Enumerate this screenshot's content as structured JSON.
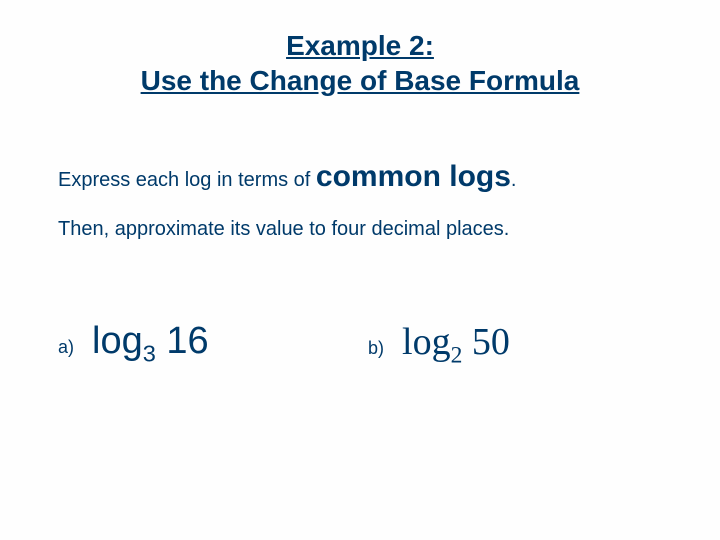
{
  "title": {
    "line1": "Example 2:",
    "line2": "Use the Change of Base Formula"
  },
  "instructions": {
    "lead": "Express each log in terms of ",
    "emphasis": "common logs",
    "tail": ".",
    "line2": "Then, approximate its value to four decimal places."
  },
  "problems": {
    "a": {
      "label": "a)",
      "log_word": "log",
      "base": "3",
      "arg": " 16"
    },
    "b": {
      "label": "b)",
      "log_word": "log",
      "base": "2",
      "arg": " 50"
    }
  }
}
